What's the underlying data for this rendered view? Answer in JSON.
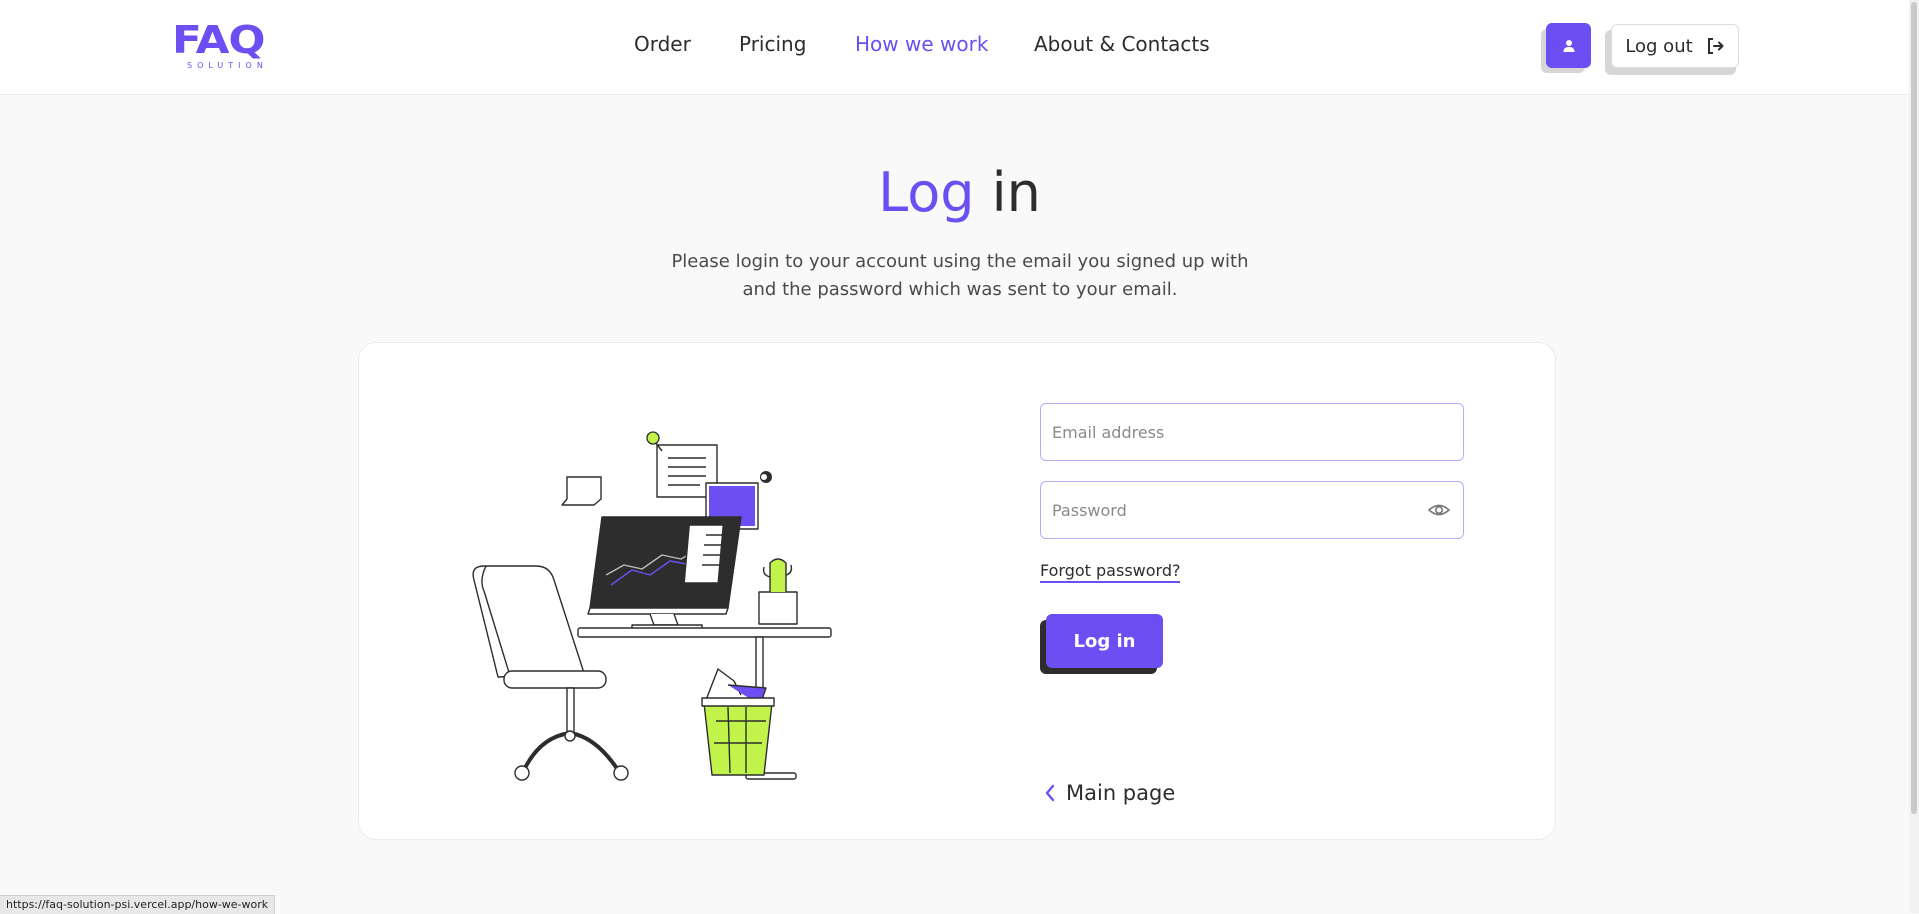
{
  "header": {
    "logo": {
      "word": "FAQ",
      "sub": "SOLUTION"
    },
    "nav": [
      {
        "label": "Order",
        "active": false
      },
      {
        "label": "Pricing",
        "active": false
      },
      {
        "label": "How we work",
        "active": true
      },
      {
        "label": "About & Contacts",
        "active": false
      }
    ],
    "user_icon": "user-icon",
    "logout_label": "Log out",
    "logout_icon": "logout-icon"
  },
  "page": {
    "title_accent": "Log",
    "title_rest": " in",
    "subtitle_line1": "Please login to your account using the email you signed up with",
    "subtitle_line2": "and the password which was sent to your email."
  },
  "form": {
    "email_placeholder": "Email address",
    "email_value": "",
    "password_placeholder": "Password",
    "password_value": "",
    "forgot_label": "Forgot password?",
    "submit_label": "Log in",
    "main_page_label": "Main page"
  },
  "illustration": {
    "name": "workspace-illustration"
  },
  "status_url": "https://faq-solution-psi.vercel.app/how-we-work",
  "colors": {
    "accent": "#6c4ef2",
    "dark": "#2d2d2d",
    "lime": "#c1f34a",
    "background": "#f9f9f9"
  }
}
